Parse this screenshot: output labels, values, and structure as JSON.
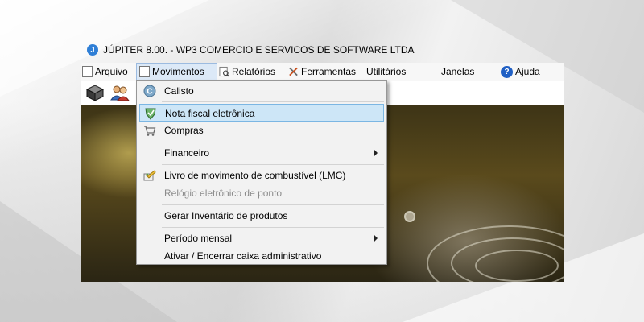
{
  "window": {
    "title": "JÚPITER 8.00. - WP3 COMERCIO E SERVICOS DE SOFTWARE LTDA",
    "logo_letter": "J"
  },
  "menubar": {
    "items": [
      {
        "label": "Arquivo",
        "icon": "document-icon"
      },
      {
        "label": "Movimentos",
        "icon": "document-icon",
        "open": true
      },
      {
        "label": "Relatórios",
        "icon": "report-icon"
      },
      {
        "label": "Ferramentas",
        "icon": "tools-icon"
      },
      {
        "label": "Utilitários"
      },
      {
        "label": "Janelas"
      },
      {
        "label": "Ajuda",
        "icon": "help-icon",
        "icon_glyph": "?"
      }
    ]
  },
  "toolbar": {
    "buttons": [
      {
        "name": "cash-register-icon"
      },
      {
        "name": "users-icon"
      }
    ]
  },
  "dropdown": {
    "items": [
      {
        "label": "Calisto",
        "icon": "calisto-icon",
        "glyph": "C"
      },
      {
        "label": "Nota fiscal eletrônica",
        "icon": "nfe-shield-icon",
        "highlighted": true
      },
      {
        "label": "Compras",
        "icon": "shopping-cart-icon"
      },
      {
        "label": "Financeiro",
        "submenu": true
      },
      {
        "label": "Livro de movimento de combustível (LMC)",
        "icon": "fuel-book-icon"
      },
      {
        "label": "Relógio eletrônico de ponto",
        "disabled": true
      },
      {
        "label": "Gerar Inventário de produtos"
      },
      {
        "label": "Período mensal",
        "submenu": true
      },
      {
        "label": "Ativar / Encerrar caixa administrativo"
      }
    ]
  },
  "colors": {
    "menu_highlight": "#cde6f7",
    "menu_highlight_border": "#7bb6e3",
    "menubar_open": "#dce9f7",
    "help_blue": "#1f5fc4"
  }
}
